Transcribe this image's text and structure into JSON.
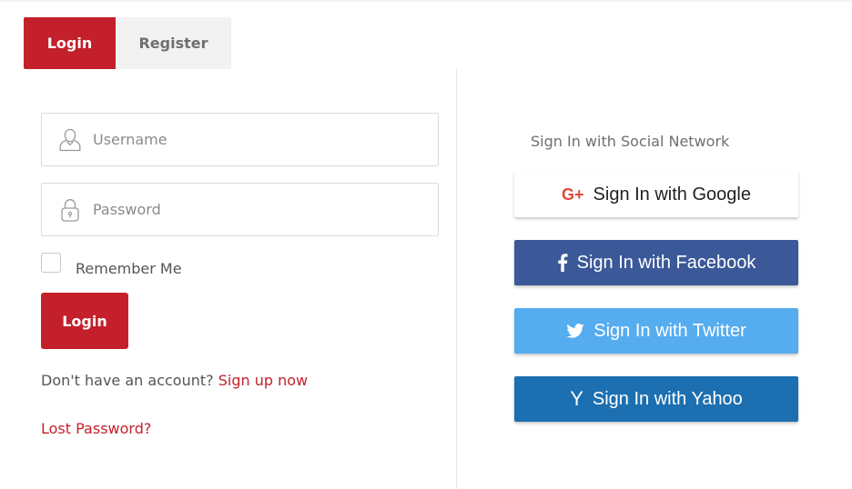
{
  "tabs": [
    {
      "label": "Login",
      "active": true
    },
    {
      "label": "Register",
      "active": false
    }
  ],
  "login_form": {
    "username_placeholder": "Username",
    "password_placeholder": "Password",
    "remember_label": "Remember Me",
    "remember_checked": false,
    "submit_label": "Login",
    "signup_prompt": "Don't have an account?",
    "signup_link": "Sign up now",
    "lost_password": "Lost Password?"
  },
  "social": {
    "title": "Sign In with Social Network",
    "buttons": [
      {
        "label": "Sign In with Google",
        "icon": "google-plus-icon",
        "color": "#ffffff"
      },
      {
        "label": "Sign In with Facebook",
        "icon": "facebook-icon",
        "color": "#3b5998"
      },
      {
        "label": "Sign In with Twitter",
        "icon": "twitter-icon",
        "color": "#55acee"
      },
      {
        "label": "Sign In with Yahoo",
        "icon": "yahoo-icon",
        "color": "#1c6fb0"
      }
    ]
  },
  "colors": {
    "accent": "#c4202b",
    "tab_inactive": "#f2f2f2"
  }
}
